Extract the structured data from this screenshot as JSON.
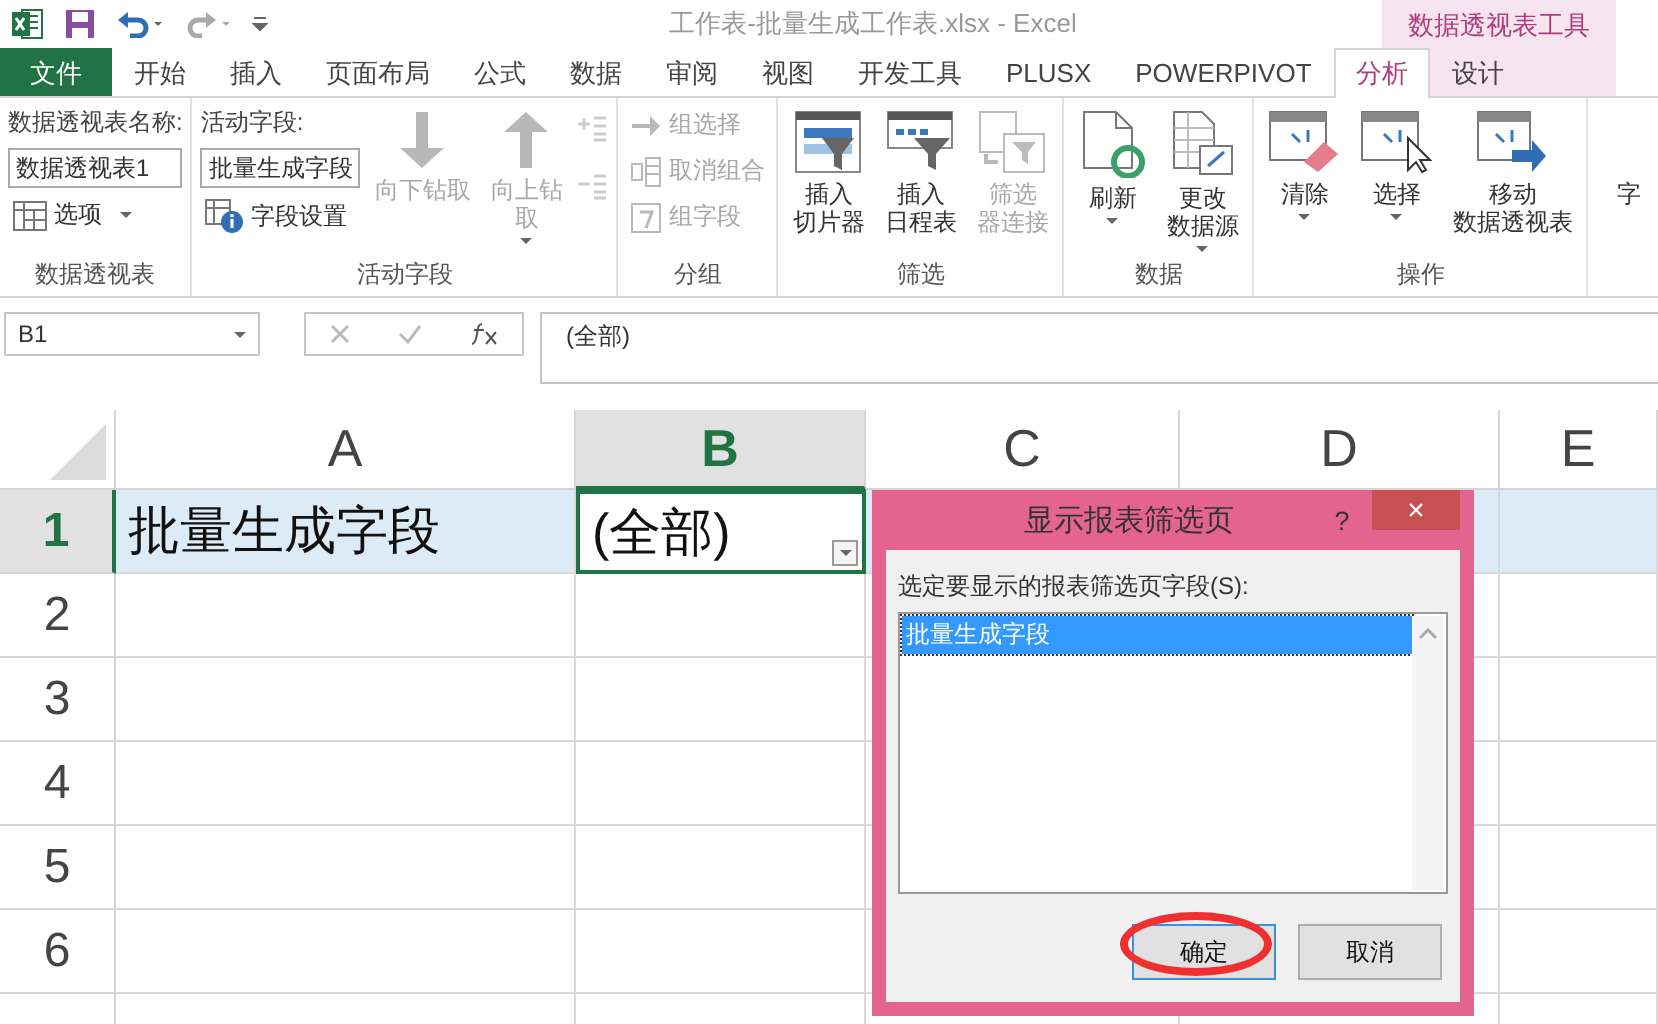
{
  "title_bar": {
    "title": "工作表-批量生成工作表.xlsx - Excel",
    "context_label": "数据透视表工具"
  },
  "tabs": [
    {
      "label": "文件",
      "kind": "file",
      "selected": false
    },
    {
      "label": "开始",
      "kind": "normal",
      "selected": false
    },
    {
      "label": "插入",
      "kind": "normal",
      "selected": false
    },
    {
      "label": "页面布局",
      "kind": "normal",
      "selected": false
    },
    {
      "label": "公式",
      "kind": "normal",
      "selected": false
    },
    {
      "label": "数据",
      "kind": "normal",
      "selected": false
    },
    {
      "label": "审阅",
      "kind": "normal",
      "selected": false
    },
    {
      "label": "视图",
      "kind": "normal",
      "selected": false
    },
    {
      "label": "开发工具",
      "kind": "normal",
      "selected": false
    },
    {
      "label": "PLUSX",
      "kind": "normal",
      "selected": false
    },
    {
      "label": "POWERPIVOT",
      "kind": "normal",
      "selected": false
    },
    {
      "label": "分析",
      "kind": "contextual",
      "selected": true
    },
    {
      "label": "设计",
      "kind": "contextual",
      "selected": false
    }
  ],
  "ribbon": {
    "groups": [
      {
        "label": "数据透视表",
        "columns": [
          [
            {
              "kind": "caption",
              "label": "数据透视表名称:"
            },
            {
              "kind": "input",
              "value": "数据透视表1"
            },
            {
              "kind": "small",
              "label": "选项",
              "disabled": false,
              "dropdown": true
            }
          ]
        ]
      },
      {
        "label": "活动字段",
        "columns": [
          [
            {
              "kind": "caption",
              "label": "活动字段:"
            },
            {
              "kind": "input",
              "value": "批量生成字段"
            },
            {
              "kind": "small",
              "label": "字段设置",
              "disabled": false,
              "dropdown": false
            }
          ],
          [
            {
              "kind": "large",
              "lines": [
                "向下钻取"
              ],
              "disabled": true,
              "dropdown": false
            }
          ],
          [
            {
              "kind": "large",
              "lines": [
                "向上钻",
                "取"
              ],
              "disabled": true,
              "dropdown": true
            }
          ],
          [
            {
              "kind": "iconic",
              "disabled": true
            },
            {
              "kind": "iconic",
              "disabled": true
            }
          ]
        ]
      },
      {
        "label": "分组",
        "columns": [
          [
            {
              "kind": "small",
              "label": "组选择",
              "disabled": true,
              "dropdown": false
            },
            {
              "kind": "small",
              "label": "取消组合",
              "disabled": true,
              "dropdown": false
            },
            {
              "kind": "small",
              "label": "组字段",
              "disabled": true,
              "dropdown": false
            }
          ]
        ]
      },
      {
        "label": "筛选",
        "columns": [
          [
            {
              "kind": "large",
              "lines": [
                "插入",
                "切片器"
              ],
              "disabled": false,
              "dropdown": false
            }
          ],
          [
            {
              "kind": "large",
              "lines": [
                "插入",
                "日程表"
              ],
              "disabled": false,
              "dropdown": false
            }
          ],
          [
            {
              "kind": "large",
              "lines": [
                "筛选",
                "器连接"
              ],
              "disabled": true,
              "dropdown": false
            }
          ]
        ]
      },
      {
        "label": "数据",
        "columns": [
          [
            {
              "kind": "large",
              "lines": [
                "刷新"
              ],
              "disabled": false,
              "dropdown": true
            }
          ],
          [
            {
              "kind": "large",
              "lines": [
                "更改",
                "数据源"
              ],
              "disabled": false,
              "dropdown": true
            }
          ]
        ]
      },
      {
        "label": "操作",
        "columns": [
          [
            {
              "kind": "large",
              "lines": [
                "清除"
              ],
              "disabled": false,
              "dropdown": true
            }
          ],
          [
            {
              "kind": "large",
              "lines": [
                "选择"
              ],
              "disabled": false,
              "dropdown": true
            }
          ],
          [
            {
              "kind": "large",
              "lines": [
                "移动",
                "数据透视表"
              ],
              "disabled": false,
              "dropdown": false
            }
          ]
        ]
      }
    ],
    "overflow_text": "字"
  },
  "formula_bar": {
    "name_box": "B1",
    "formula": "(全部)"
  },
  "grid": {
    "columns": [
      {
        "label": "A",
        "selected": false
      },
      {
        "label": "B",
        "selected": true
      },
      {
        "label": "C",
        "selected": false
      },
      {
        "label": "D",
        "selected": false
      },
      {
        "label": "E",
        "selected": false
      }
    ],
    "rows": [
      {
        "label": "1",
        "selected": true,
        "cells": [
          {
            "value": "批量生成字段",
            "dropdown": false,
            "active": false
          },
          {
            "value": "(全部)",
            "dropdown": true,
            "active": true
          }
        ]
      },
      {
        "label": "2",
        "selected": false,
        "cells": []
      },
      {
        "label": "3",
        "selected": false,
        "cells": []
      },
      {
        "label": "4",
        "selected": false,
        "cells": []
      },
      {
        "label": "5",
        "selected": false,
        "cells": []
      },
      {
        "label": "6",
        "selected": false,
        "cells": []
      }
    ]
  },
  "dialog": {
    "title": "显示报表筛选页",
    "help": "?",
    "close": "×",
    "prompt": "选定要显示的报表筛选页字段(S):",
    "items": [
      {
        "label": "批量生成字段",
        "selected": true
      }
    ],
    "buttons": [
      {
        "label": "确定",
        "kind": "ok",
        "circled": true
      },
      {
        "label": "取消",
        "kind": "cancel",
        "circled": false
      }
    ]
  }
}
